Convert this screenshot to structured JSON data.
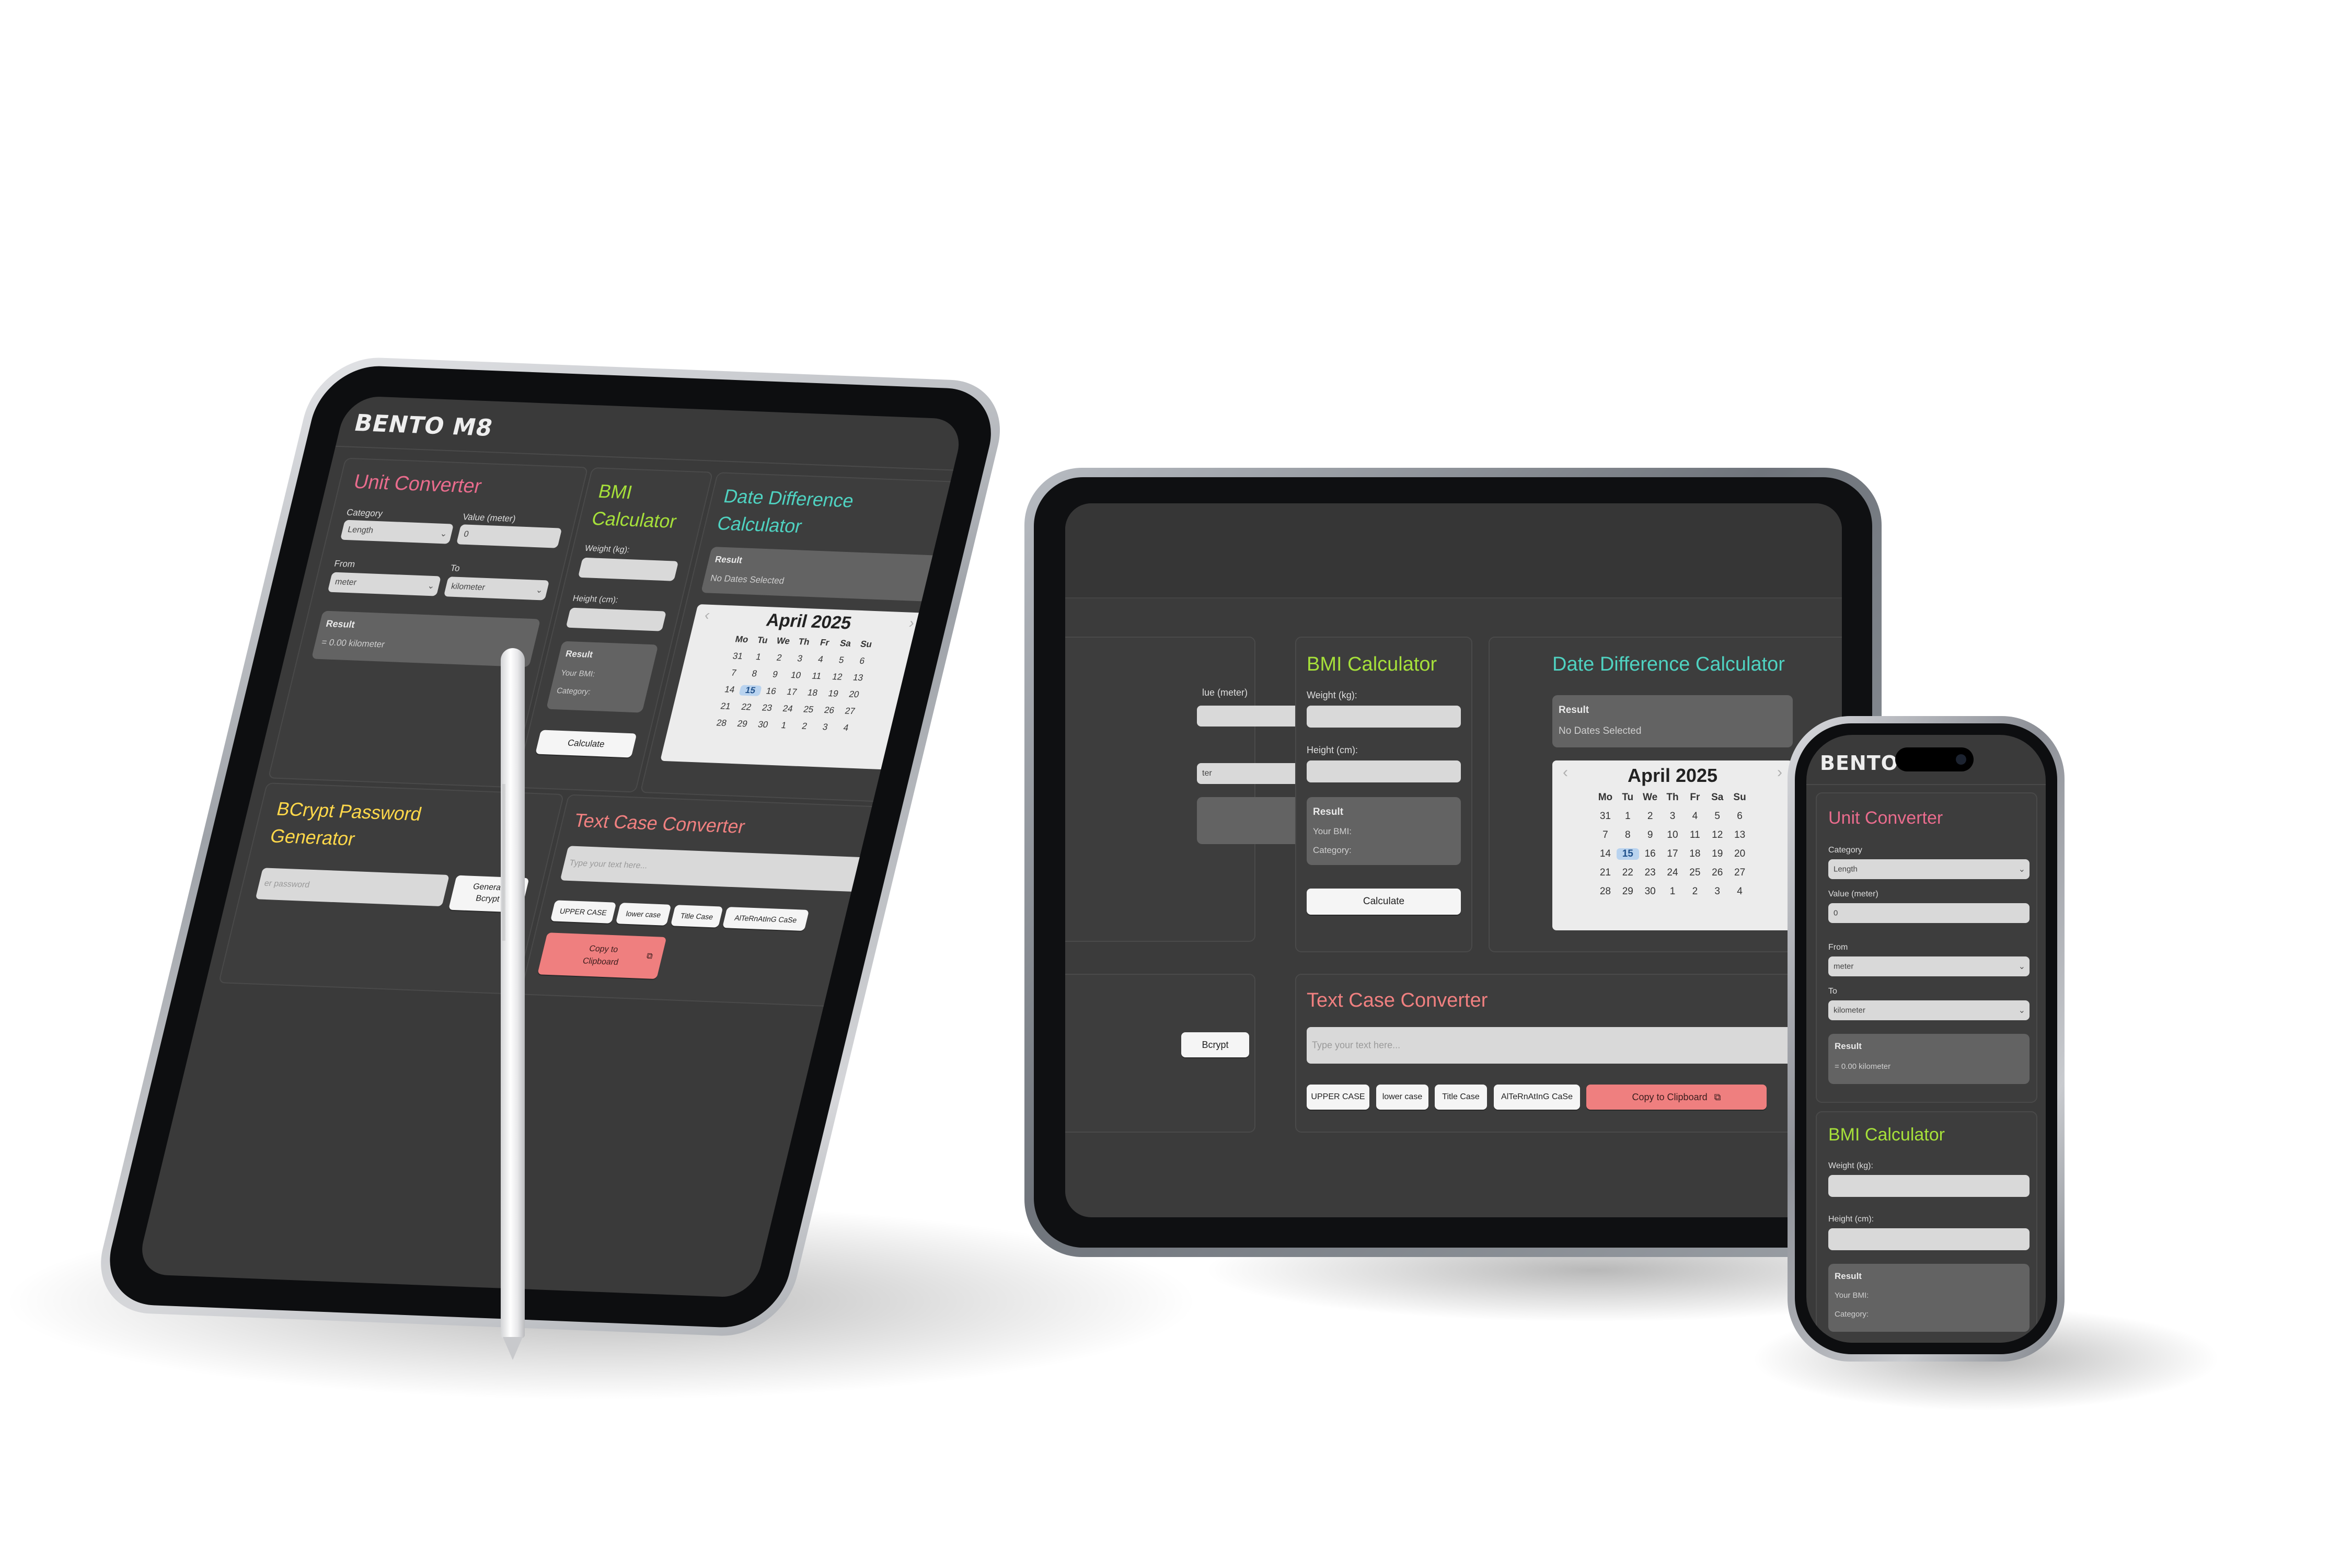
{
  "app": {
    "logo": "BENTO M8"
  },
  "unit_converter": {
    "title": "Unit Converter",
    "category_label": "Category",
    "category_value": "Length",
    "value_label": "Value (meter)",
    "value": "0",
    "from_label": "From",
    "from_value": "meter",
    "to_label": "To",
    "to_value": "kilometer",
    "result_title": "Result",
    "result_text": "= 0.00 kilometer"
  },
  "bmi": {
    "title": "BMI Calculator",
    "title_line1": "BMI",
    "title_line2": "Calculator",
    "weight_label": "Weight (kg):",
    "height_label": "Height (cm):",
    "result_title": "Result",
    "your_bmi": "Your BMI:",
    "category": "Category:",
    "button": "Calculate"
  },
  "date_diff": {
    "title": "Date Difference Calculator",
    "title_line1": "Date Difference",
    "title_line2": "Calculator",
    "result_title": "Result",
    "result_text": "No Dates Selected",
    "calendar": {
      "month": "April 2025",
      "prev": "‹",
      "next": "›",
      "weekdays": [
        "Mo",
        "Tu",
        "We",
        "Th",
        "Fr",
        "Sa",
        "Su"
      ],
      "days": [
        "31",
        "1",
        "2",
        "3",
        "4",
        "5",
        "6",
        "7",
        "8",
        "9",
        "10",
        "11",
        "12",
        "13",
        "14",
        "15",
        "16",
        "17",
        "18",
        "19",
        "20",
        "21",
        "22",
        "23",
        "24",
        "25",
        "26",
        "27",
        "28",
        "29",
        "30",
        "1",
        "2",
        "3",
        "4"
      ],
      "selected_day": "15"
    }
  },
  "bcrypt": {
    "title_line1": "BCrypt Password",
    "title_line2": "Generator",
    "title_visible_line1": "Bc",
    "title_visible_line1b": "pt Password",
    "title_visible_line2a": "G",
    "title_visible_line2b": "erator",
    "input_placeholder": "er password",
    "button_line1": "Generate",
    "button_line2": "Bcrypt",
    "laptop_button_partial": "Bcrypt"
  },
  "text_case": {
    "title": "Text Case Converter",
    "placeholder": "Type your text here...",
    "buttons": [
      "UPPER CASE",
      "lower case",
      "Title Case",
      "AlTeRnAtInG CaSe"
    ],
    "copy_button": "Copy to Clipboard",
    "copy_line1": "Copy to",
    "copy_line2": "Clipboard",
    "copy_icon": "⧉"
  },
  "laptop_partial": {
    "value_label": "lue (meter)",
    "select_value": "ter"
  },
  "phone": {
    "logo": "BENTO"
  },
  "colors": {
    "accent_pink": "#e96c8d",
    "accent_green": "#a6e03a",
    "accent_teal": "#4fd2c1",
    "accent_yellow": "#ffd84a",
    "accent_salmon": "#f08080"
  },
  "icons": [
    "chevron-down-icon",
    "copy-icon",
    "chevron-left-icon",
    "chevron-right-icon"
  ]
}
